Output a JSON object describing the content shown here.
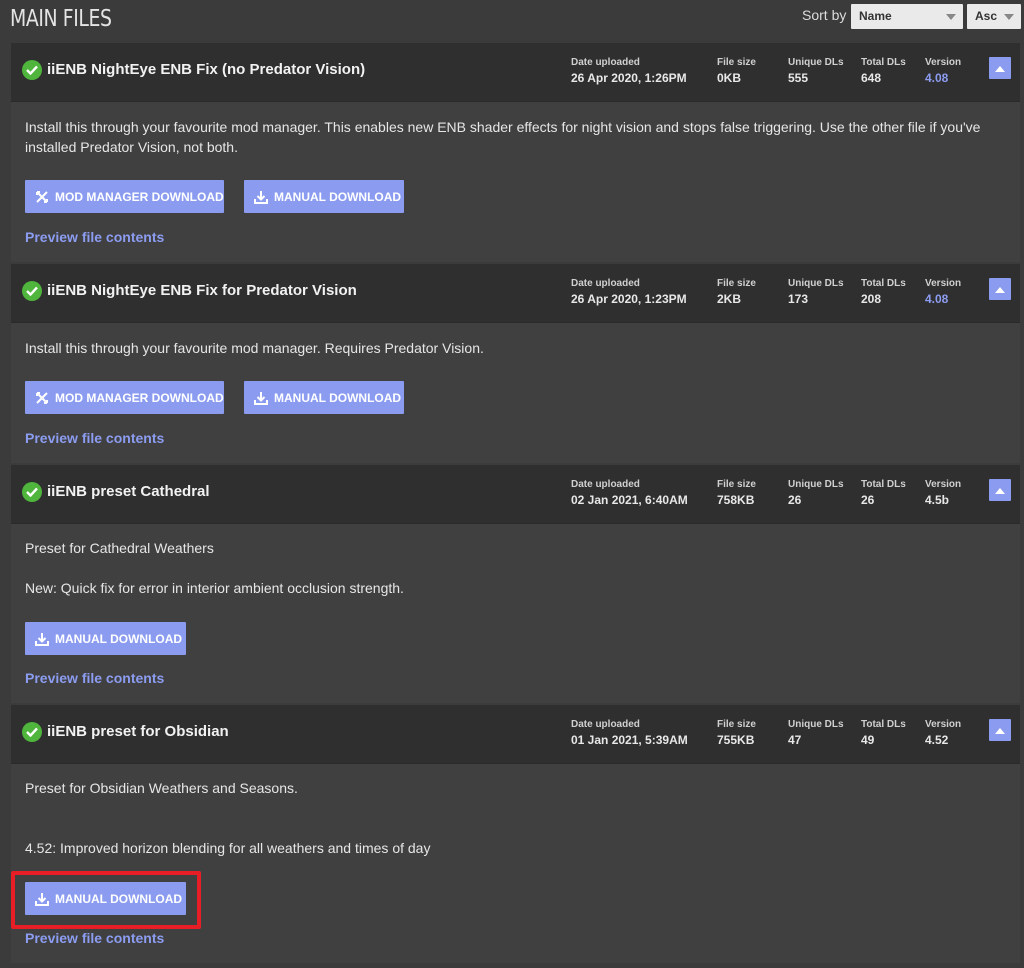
{
  "header": {
    "title": "MAIN FILES",
    "sort_label": "Sort by",
    "sort_field": "Name",
    "sort_order": "Asc"
  },
  "stat_labels": {
    "date": "Date uploaded",
    "size": "File size",
    "unique": "Unique DLs",
    "total": "Total DLs",
    "version": "Version"
  },
  "files": [
    {
      "name": "iiENB NightEye ENB Fix (no Predator Vision)",
      "date": "26 Apr 2020, 1:26PM",
      "size": "0KB",
      "unique": "555",
      "total": "648",
      "version": "4.08",
      "desc1": "Install this through your favourite mod manager. This enables new ENB shader effects for night vision and stops false triggering. Use the other file if you've installed Predator Vision, not both.",
      "mod_manager_label": "MOD MANAGER DOWNLOAD",
      "manual_label": "MANUAL DOWNLOAD",
      "preview_label": "Preview file contents"
    },
    {
      "name": "iiENB NightEye ENB Fix for Predator Vision",
      "date": "26 Apr 2020, 1:23PM",
      "size": "2KB",
      "unique": "173",
      "total": "208",
      "version": "4.08",
      "desc1": "Install this through your favourite mod manager. Requires Predator Vision.",
      "mod_manager_label": "MOD MANAGER DOWNLOAD",
      "manual_label": "MANUAL DOWNLOAD",
      "preview_label": "Preview file contents"
    },
    {
      "name": "iiENB preset Cathedral",
      "date": "02 Jan 2021, 6:40AM",
      "size": "758KB",
      "unique": "26",
      "total": "26",
      "version": "4.5b",
      "desc1": "Preset for Cathedral Weathers",
      "desc2": "New: Quick fix for error in interior ambient occlusion strength.",
      "manual_label": "MANUAL DOWNLOAD",
      "preview_label": "Preview file contents"
    },
    {
      "name": "iiENB preset for Obsidian",
      "date": "01 Jan 2021, 5:39AM",
      "size": "755KB",
      "unique": "47",
      "total": "49",
      "version": "4.52",
      "desc1": "Preset for Obsidian Weathers and Seasons.",
      "desc2": "4.52: Improved horizon blending for all weathers and times of day",
      "manual_label": "MANUAL DOWNLOAD",
      "preview_label": "Preview file contents"
    }
  ],
  "colors": {
    "accent": "#8b9cf0",
    "link": "#8c9cf0",
    "check": "#4fb53c",
    "highlight": "#e81e26",
    "background": "#3b3b3b",
    "header_bg": "#2f2f2f"
  },
  "icons": {
    "check": "check-circle-icon",
    "mod_manager": "vortex-icon",
    "manual": "download-icon",
    "collapse": "chevron-up-icon",
    "caret": "caret-down-icon"
  }
}
